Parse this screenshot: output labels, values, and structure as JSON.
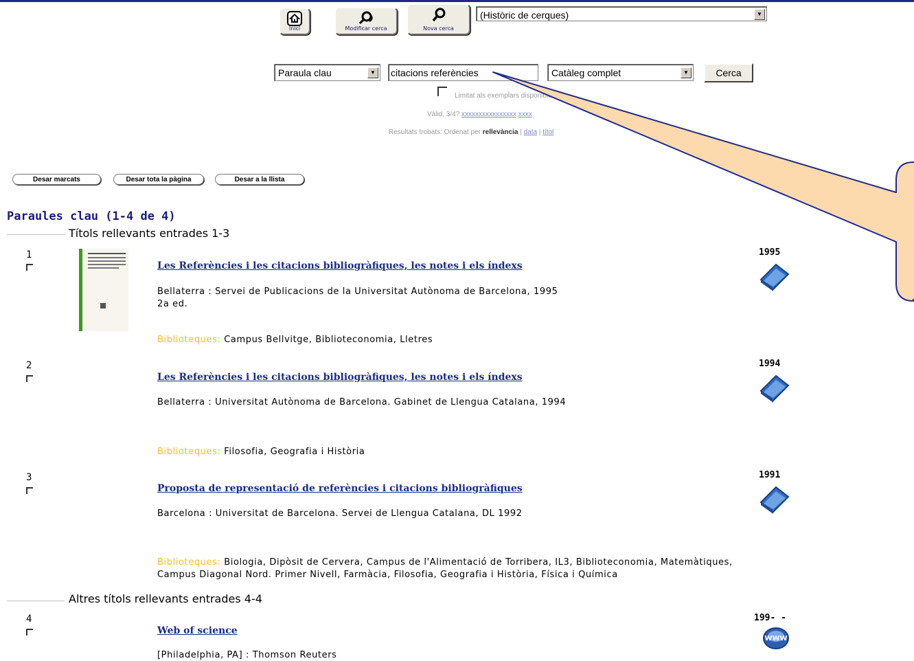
{
  "toolbar": {
    "home_label": "Inici",
    "modify_label": "Modificar cerca",
    "new_label": "Nova cerca",
    "history_value": "(Històric de cerques)"
  },
  "search": {
    "type_value": "Paraula clau",
    "query_value": "citacions referències",
    "catalog_value": "Catàleg complet",
    "submit_label": "Cerca",
    "limit_label": "Limitat als exemplars disponibles",
    "help_text": "Vàlid, 3/4? ",
    "help_link": "xxxxxxxxxxxxxxxx",
    "help_link2": "xxxx",
    "sort_text": "Resultats trobats: Ordenat per ",
    "sort_bold": "rellevància",
    "sort_link1": "data",
    "sort_link2": "títol"
  },
  "actions": {
    "save_marked": "Desar marcats",
    "save_page": "Desar tota la pàgina",
    "save_list": "Desar a la llista"
  },
  "results": {
    "heading": "Paraules clau (1-4 de 4)",
    "section1": "Títols rellevants entrades 1-3",
    "section2": "Altres títols rellevants entrades 4-4",
    "libraries_label": "Biblioteques:",
    "items": [
      {
        "num": "1",
        "title": "Les Referències i les citacions bibliogràfiques, les notes i els índexs",
        "pub": "Bellaterra : Servei de Publicacions de la Universitat Autònoma de Barcelona, 1995",
        "edition": "2a ed.",
        "libraries": "Campus Bellvitge, Biblioteconomia, Lletres",
        "year": "1995"
      },
      {
        "num": "2",
        "title": "Les Referències i les citacions bibliogràfiques, les notes i els índexs",
        "pub": "Bellaterra : Universitat Autònoma de Barcelona. Gabinet de Llengua Catalana, 1994",
        "libraries": "Filosofia, Geografia i Història",
        "year": "1994"
      },
      {
        "num": "3",
        "title": "Proposta de representació de referències i citacions bibliogràfiques",
        "pub": "Barcelona : Universitat de Barcelona. Servei de Llengua Catalana, DL 1992",
        "libraries_line1": "Biologia, Dipòsit de Cervera, Campus de l'Alimentació de Torribera, IL3, Biblioteconomia, Matemàtiques,",
        "libraries_line2": "Campus Diagonal Nord. Primer Nivell, Farmàcia, Filosofia, Geografia i Història, Física i Química",
        "year": "1991"
      },
      {
        "num": "4",
        "title": "Web of science",
        "pub": "[Philadelphia, PA] : Thomson Reuters",
        "year": "199- -"
      }
    ]
  },
  "colors": {
    "link": "#1a2a8a",
    "libraries_label": "#f2c21a",
    "callout_fill": "#fdd9ae",
    "top_border": "#1e2a8a"
  }
}
